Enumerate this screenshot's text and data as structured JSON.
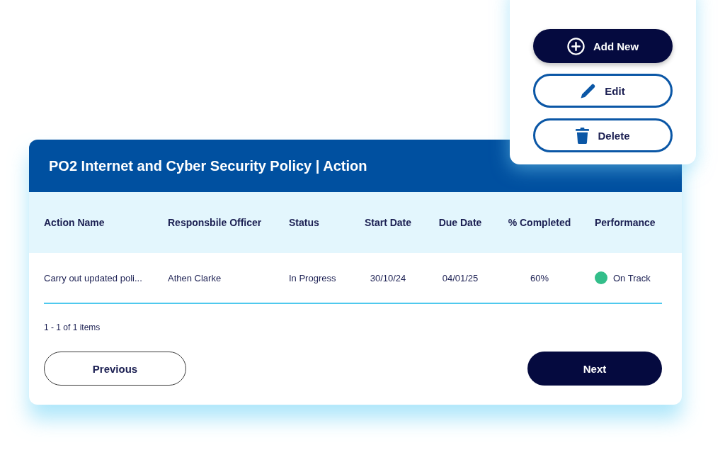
{
  "action_menu": {
    "buttons": [
      {
        "kind": "primary",
        "label": "Add New"
      },
      {
        "kind": "outline",
        "label": "Edit"
      },
      {
        "kind": "outline",
        "label": "Delete"
      }
    ]
  },
  "panel": {
    "title": "PO2 Internet and Cyber Security Policy | Action",
    "table": {
      "columns": [
        "Action Name",
        "Responsbile Officer",
        "Status",
        "Start Date",
        "Due Date",
        "% Completed",
        "Performance"
      ],
      "rows": [
        {
          "cells": [
            "Carry out updated poli...",
            "Athen Clarke",
            "In Progress",
            "30/10/24",
            "04/01/25",
            "60%"
          ],
          "performance": {
            "label": "On Track",
            "color": "#33be8a"
          }
        }
      ]
    },
    "item_count": "1 - 1 of 1 items",
    "pagination": [
      {
        "kind": "outline",
        "label": "Previous"
      },
      {
        "kind": "primary",
        "label": "Next"
      }
    ]
  }
}
